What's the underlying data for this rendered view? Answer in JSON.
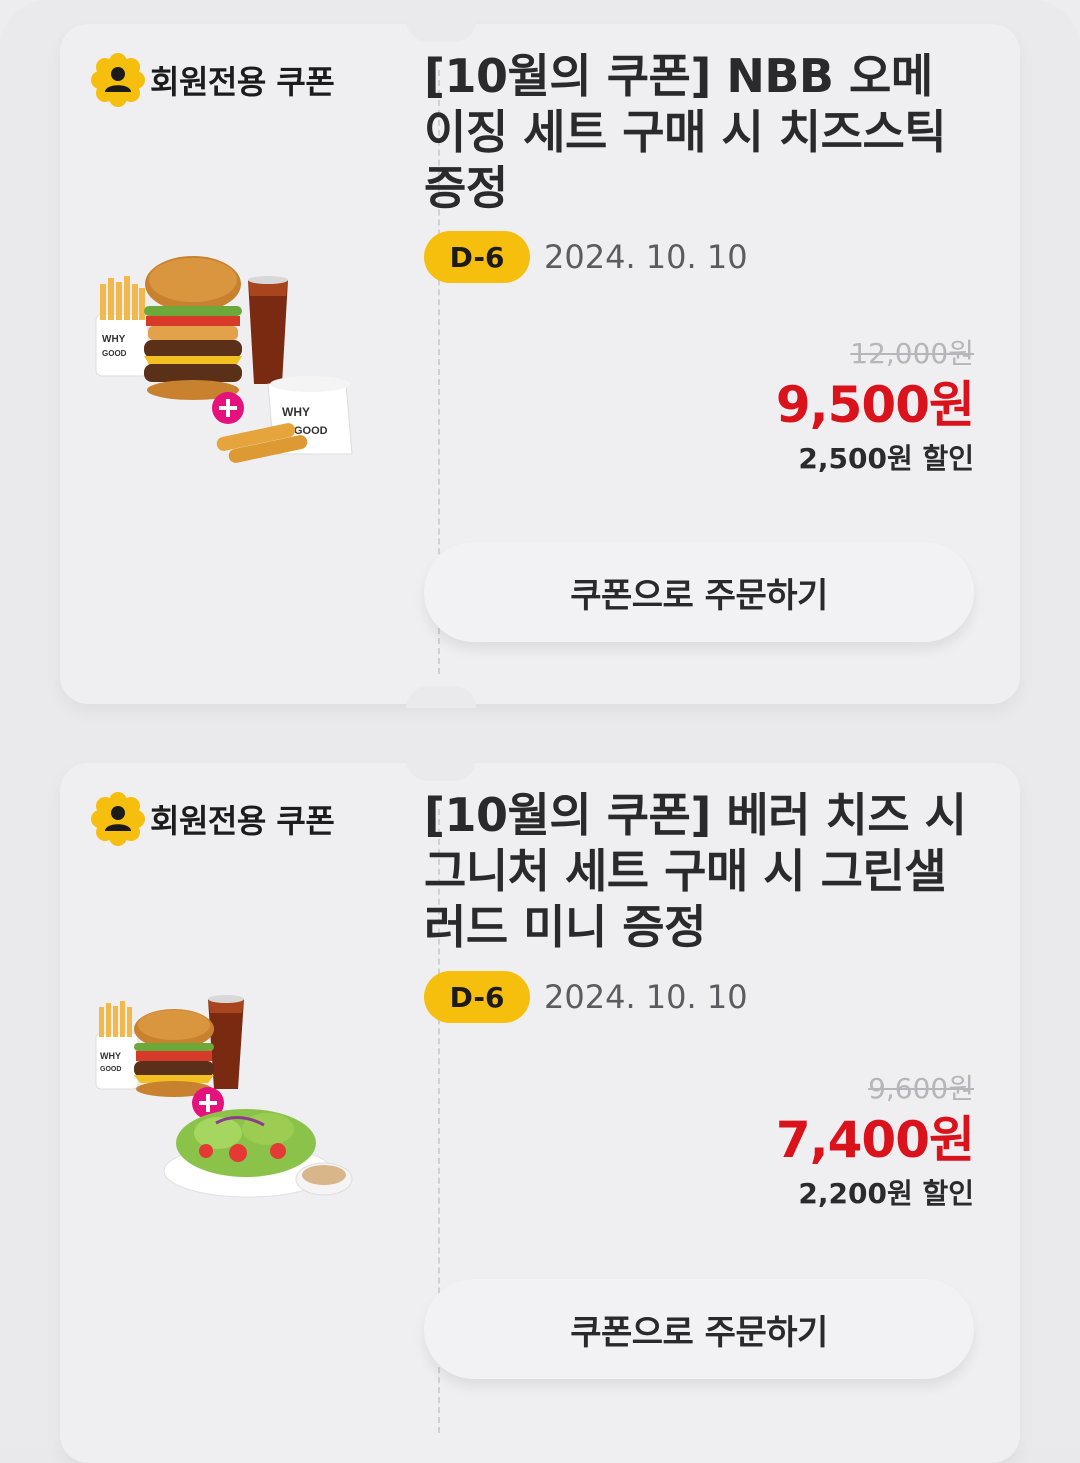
{
  "coupons": [
    {
      "badge_label": "회원전용 쿠폰",
      "badge_icon": "member-icon",
      "title": "[10월의 쿠폰] NBB 오메이징 세트 구매 시 치즈스틱 증정",
      "dday": "D-6",
      "date": "2024. 10. 10",
      "original_price": "12,000원",
      "sale_price": "9,500원",
      "discount": "2,500원 할인",
      "button_label": "쿠폰으로 주문하기",
      "image": "burger-set-with-cheese-sticks"
    },
    {
      "badge_label": "회원전용 쿠폰",
      "badge_icon": "member-icon",
      "title": "[10월의 쿠폰] 베러 치즈 시그니처 세트 구매 시 그린샐러드 미니 증정",
      "dday": "D-6",
      "date": "2024. 10. 10",
      "original_price": "9,600원",
      "sale_price": "7,400원",
      "discount": "2,200원 할인",
      "button_label": "쿠폰으로 주문하기",
      "image": "burger-set-with-green-salad"
    }
  ],
  "colors": {
    "accent_yellow": "#f6bf0e",
    "sale_red": "#d9121c",
    "background": "#eaeaed",
    "card": "#efeff2"
  }
}
